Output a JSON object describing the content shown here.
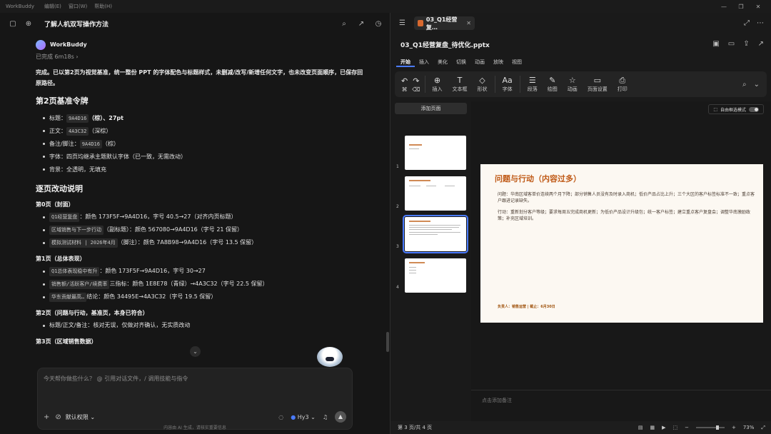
{
  "titlebar": {
    "app_name": "WorkBuddy",
    "menus": [
      "编辑(E)",
      "窗口(W)",
      "帮助(H)"
    ],
    "controls": [
      "—",
      "❐",
      "✕"
    ]
  },
  "left_header": {
    "title": "了解人机双写操作方法"
  },
  "chat": {
    "bot_name": "WorkBuddy",
    "status": "已完成 6m18s",
    "summary": "完成。已以第2页为视觉基准，统一整份 PPT 的字体配色与标题样式，未删减/改写/新增任何文字，也未改变页面顺序，已保存回原路径。",
    "section1_title": "第2页基准令牌",
    "tokens": [
      {
        "pre": "标题：",
        "code": "9A4D16",
        "post": "（棕）、27pt"
      },
      {
        "pre": "正文：",
        "code": "4A3C32",
        "post": "（深棕）"
      },
      {
        "pre": "备注/脚注：",
        "code": "9A4D16",
        "post": "（棕）"
      },
      {
        "pre": "字体：四页均继承主题默认字体（已一致，无需改动）",
        "code": "",
        "post": ""
      },
      {
        "pre": "背景：全透明，无填充",
        "code": "",
        "post": ""
      }
    ],
    "section2_title": "逐页改动说明",
    "page0_title": "第0页（封面）",
    "page0_items": [
      {
        "code": "Q1经营复盘",
        "post": "：颜色 173F5F→9A4D16，字号 40.5→27（对齐内页标题）"
      },
      {
        "code": "区域销售与下一步行动",
        "post": "（副标题）：颜色 567080→9A4D16（字号 21 保留）"
      },
      {
        "code": "模拟测试材料 | 2026年4月",
        "post": "（脚注）：颜色 7A8B98→9A4D16（字号 13.5 保留）"
      }
    ],
    "page1_title": "第1页（总体表现）",
    "page1_items": [
      {
        "code": "Q1总体表现稳中有升",
        "post": "：颜色 173F5F→9A4D16，字号 30→27"
      },
      {
        "code": "销售额/活跃客户/续费率",
        "post": " 三指标：颜色 1E8E78（青绿）→4A3C32（字号 22.5 保留）"
      },
      {
        "code": "华东贡献最高…",
        "post": " 结论：颜色 34495E→4A3C32（字号 19.5 保留）"
      }
    ],
    "page2_title": "第2页（问题与行动，基准页，本身已符合）",
    "page2_items": [
      {
        "pre": "标题/正文/备注：核对无误，仅做对齐确认，无实质改动"
      }
    ],
    "page3_title": "第3页（区域销售数据）"
  },
  "input": {
    "placeholder": "今天帮你做些什么？ @ 引用对话文件，/ 调用技能与指令",
    "permission": "默认权限",
    "model": "Hy3"
  },
  "disclaimer": "内容由 AI 生成，请核实重要信息",
  "right": {
    "tab_label": "03_Q1经营复…",
    "file_name": "03_Q1经营复盘_待优化.pptx",
    "ribbon_tabs": [
      "开始",
      "插入",
      "美化",
      "切换",
      "动画",
      "放映",
      "视图"
    ],
    "ribbon_tools": [
      "插入",
      "文本框",
      "形状",
      "字体",
      "段落",
      "绘图",
      "动画",
      "页面设置",
      "打印"
    ],
    "add_page": "添加页面",
    "thumb_numbers": [
      "1",
      "2",
      "3",
      "4"
    ],
    "autofit_label": "自由框选模式",
    "slide": {
      "title": "问题与行动（内容过多）",
      "p1": "问题：华南区域客单价连续两个月下降；部分销售人员没有及时录入商机；低价产品占比上升；三个大区的客户标签标准不一致；重点客户跟进记录缺失。",
      "p2": "行动：重新划分客户等级；要求每周五完成商机更新；为低价产品设计升级包；统一客户标签；建立重点客户复盘会；调整华南激励政策；补充区域培训。",
      "footer": "负责人：销售运营 | 截止：6月30日"
    },
    "notes_placeholder": "点击添加备注",
    "page_indicator": "第 3 页/共 4 页",
    "zoom": "73%"
  }
}
